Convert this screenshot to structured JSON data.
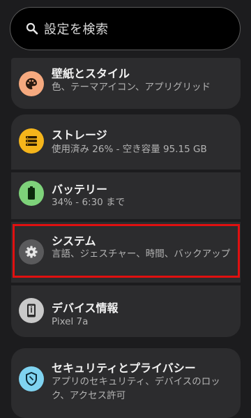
{
  "search": {
    "placeholder": "設定を検索",
    "icon": "search-icon"
  },
  "items": [
    {
      "title": "壁紙とスタイル",
      "subtitle": "色、テーマアイコン、アプリグリッド",
      "icon": "palette-icon",
      "color": "#f5a97f"
    },
    {
      "title": "ストレージ",
      "subtitle": "使用済み 26% - 空き容量 95.15 GB",
      "icon": "storage-icon",
      "color": "#f5b51b"
    },
    {
      "title": "バッテリー",
      "subtitle": "34% - 6:30 まで",
      "icon": "battery-icon",
      "color": "#7ed27a"
    },
    {
      "title": "システム",
      "subtitle": "言語、ジェスチャー、時間、バックアップ",
      "icon": "gear-icon",
      "color": "#5a5a5c"
    },
    {
      "title": "デバイス情報",
      "subtitle": "Pixel 7a",
      "icon": "phone-info-icon",
      "color": "#c9c9c9"
    },
    {
      "title": "セキュリティとプライバシー",
      "subtitle": "アプリのセキュリティ、デバイスのロック、アクセス許可",
      "icon": "shield-icon",
      "color": "#7fd3f0"
    }
  ],
  "highlight_color": "#e01010"
}
